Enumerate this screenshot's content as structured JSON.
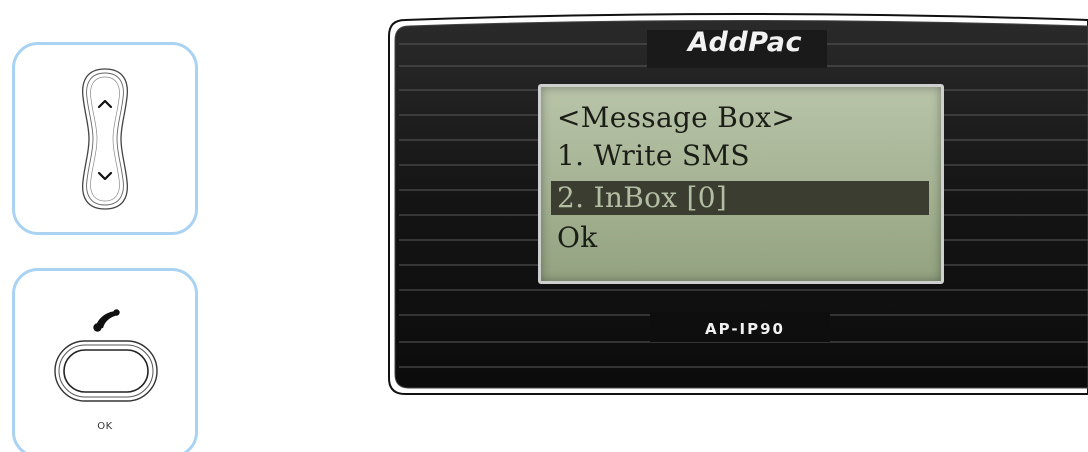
{
  "keys": {
    "nav": {
      "up_icon": "chevron-up-icon",
      "down_icon": "chevron-down-icon"
    },
    "ok": {
      "icon": "handset-icon",
      "label": "OK"
    },
    "panel_border_color": "#a9d2f3"
  },
  "phone": {
    "brand": "AddPac",
    "model": "AP-IP90",
    "bezel_color": "#1a1a1a",
    "lcd_color": "#a4b292",
    "screen": {
      "lines": [
        {
          "text": "<Message Box>",
          "selected": false
        },
        {
          "text": "1. Write SMS",
          "selected": false
        },
        {
          "text": "2. InBox [0]",
          "selected": true
        },
        {
          "text": "Ok",
          "selected": false
        }
      ]
    }
  }
}
